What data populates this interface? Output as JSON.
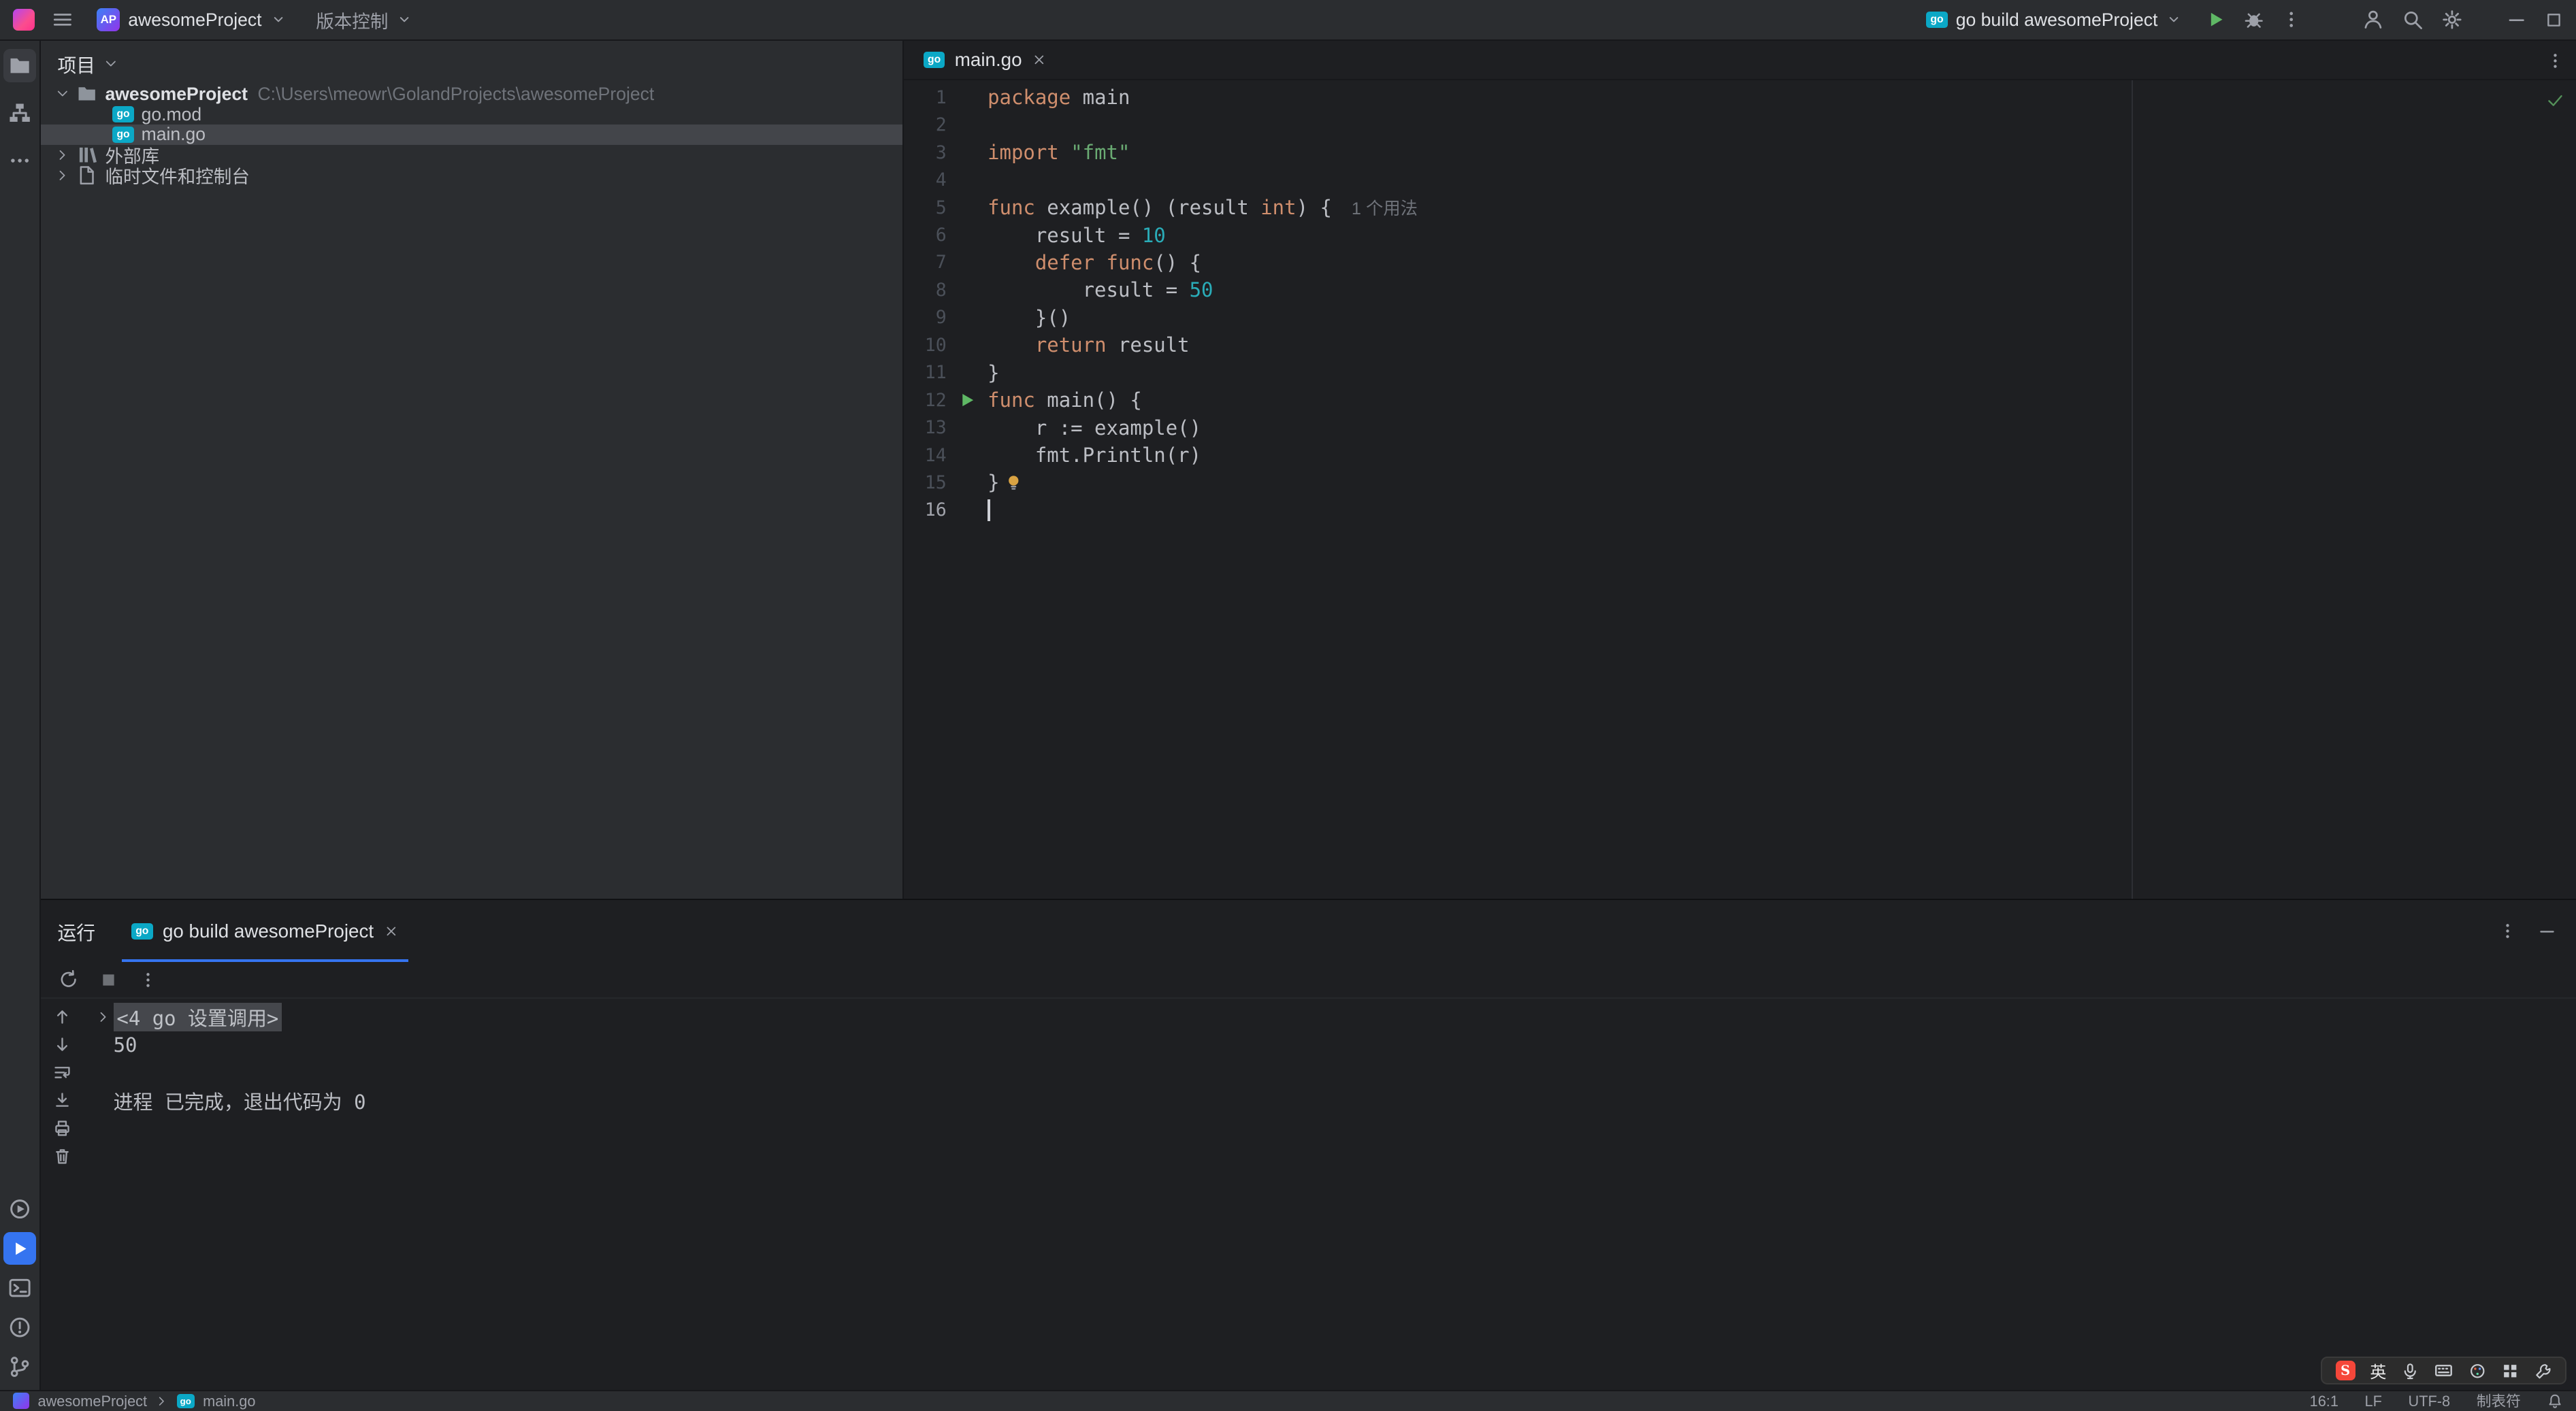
{
  "titlebar": {
    "project_badge": "AP",
    "project_name": "awesomeProject",
    "vcs_label": "版本控制",
    "run_config_label": "go build awesomeProject"
  },
  "project_panel": {
    "title": "项目",
    "tree": [
      {
        "level": 0,
        "expander": "down",
        "icon": "folder",
        "label": "awesomeProject",
        "path": "C:\\Users\\meowr\\GolandProjects\\awesomeProject",
        "bold": true,
        "selected": false
      },
      {
        "level": 1,
        "expander": "",
        "icon": "gomod",
        "label": "go.mod",
        "path": "",
        "bold": false,
        "selected": false
      },
      {
        "level": 1,
        "expander": "",
        "icon": "gofile",
        "label": "main.go",
        "path": "",
        "bold": false,
        "selected": true
      },
      {
        "level": 0,
        "expander": "right",
        "icon": "lib",
        "label": "外部库",
        "path": "",
        "bold": false,
        "selected": false
      },
      {
        "level": 0,
        "expander": "right",
        "icon": "scratch",
        "label": "临时文件和控制台",
        "path": "",
        "bold": false,
        "selected": false
      }
    ]
  },
  "editor": {
    "tab_label": "main.go",
    "code_lines": [
      {
        "n": "1",
        "segs": [
          {
            "c": "kw",
            "t": "package"
          },
          {
            "c": "fg",
            "t": " main"
          }
        ]
      },
      {
        "n": "2",
        "segs": []
      },
      {
        "n": "3",
        "segs": [
          {
            "c": "kw",
            "t": "import"
          },
          {
            "c": "fg",
            "t": " "
          },
          {
            "c": "str",
            "t": "\"fmt\""
          }
        ]
      },
      {
        "n": "4",
        "segs": []
      },
      {
        "n": "5",
        "segs": [
          {
            "c": "kw",
            "t": "func"
          },
          {
            "c": "fg",
            "t": " example() (result "
          },
          {
            "c": "kw",
            "t": "int"
          },
          {
            "c": "fg",
            "t": ") {"
          },
          {
            "c": "hint",
            "t": "1 个用法"
          }
        ]
      },
      {
        "n": "6",
        "segs": [
          {
            "c": "fg",
            "t": "    result = "
          },
          {
            "c": "num",
            "t": "10"
          }
        ]
      },
      {
        "n": "7",
        "segs": [
          {
            "c": "fg",
            "t": "    "
          },
          {
            "c": "kw",
            "t": "defer"
          },
          {
            "c": "fg",
            "t": " "
          },
          {
            "c": "kw",
            "t": "func"
          },
          {
            "c": "fg",
            "t": "() {"
          }
        ]
      },
      {
        "n": "8",
        "segs": [
          {
            "c": "fg",
            "t": "        result = "
          },
          {
            "c": "num",
            "t": "50"
          }
        ]
      },
      {
        "n": "9",
        "segs": [
          {
            "c": "fg",
            "t": "    }()"
          }
        ]
      },
      {
        "n": "10",
        "segs": [
          {
            "c": "fg",
            "t": "    "
          },
          {
            "c": "kw",
            "t": "return"
          },
          {
            "c": "fg",
            "t": " result"
          }
        ]
      },
      {
        "n": "11",
        "segs": [
          {
            "c": "fg",
            "t": "}"
          }
        ]
      },
      {
        "n": "12",
        "run": true,
        "segs": [
          {
            "c": "kw",
            "t": "func"
          },
          {
            "c": "fg",
            "t": " main() {"
          }
        ]
      },
      {
        "n": "13",
        "segs": [
          {
            "c": "fg",
            "t": "    r := example()"
          }
        ]
      },
      {
        "n": "14",
        "segs": [
          {
            "c": "fg",
            "t": "    fmt.Println(r)"
          }
        ]
      },
      {
        "n": "15",
        "bulb": true,
        "segs": [
          {
            "c": "fg",
            "t": "}"
          }
        ]
      },
      {
        "n": "16",
        "cursor": true,
        "segs": []
      }
    ]
  },
  "run_panel": {
    "title": "运行",
    "tab_label": "go build awesomeProject",
    "console_lines": [
      {
        "fold": true,
        "text": "<4 go 设置调用>"
      },
      {
        "fold": false,
        "text": "50"
      },
      {
        "fold": false,
        "text": ""
      },
      {
        "fold": false,
        "text": "进程 已完成，退出代码为 0"
      }
    ]
  },
  "statusbar": {
    "breadcrumb_project": "awesomeProject",
    "breadcrumb_file": "main.go",
    "caret": "16:1",
    "line_ending": "LF",
    "encoding": "UTF-8",
    "indent": "制表符"
  },
  "ime": {
    "lang_label": "英"
  }
}
